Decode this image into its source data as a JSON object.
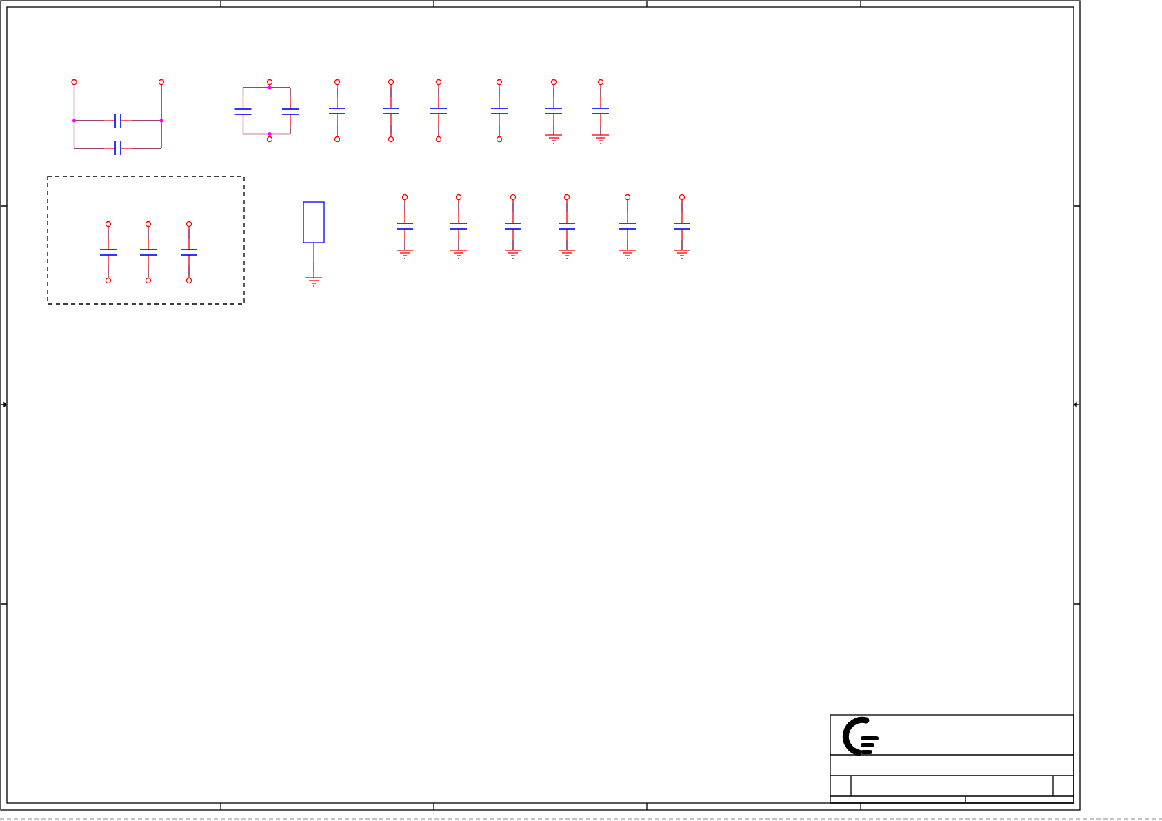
{
  "sheet": {
    "parts": [
      {
        "kind": "parallel_pair"
      },
      {
        "kind": "bridge_pair"
      },
      {
        "kind": "capacitor"
      },
      {
        "kind": "capacitor"
      },
      {
        "kind": "capacitor"
      },
      {
        "kind": "capacitor"
      },
      {
        "kind": "grounded_capacitor"
      },
      {
        "kind": "grounded_capacitor"
      },
      {
        "kind": "capacitor_group"
      },
      {
        "kind": "grounded_resistor"
      },
      {
        "kind": "grounded_capacitor"
      },
      {
        "kind": "grounded_capacitor"
      },
      {
        "kind": "grounded_capacitor"
      },
      {
        "kind": "grounded_capacitor"
      },
      {
        "kind": "grounded_capacitor"
      },
      {
        "kind": "grounded_capacitor"
      }
    ]
  }
}
